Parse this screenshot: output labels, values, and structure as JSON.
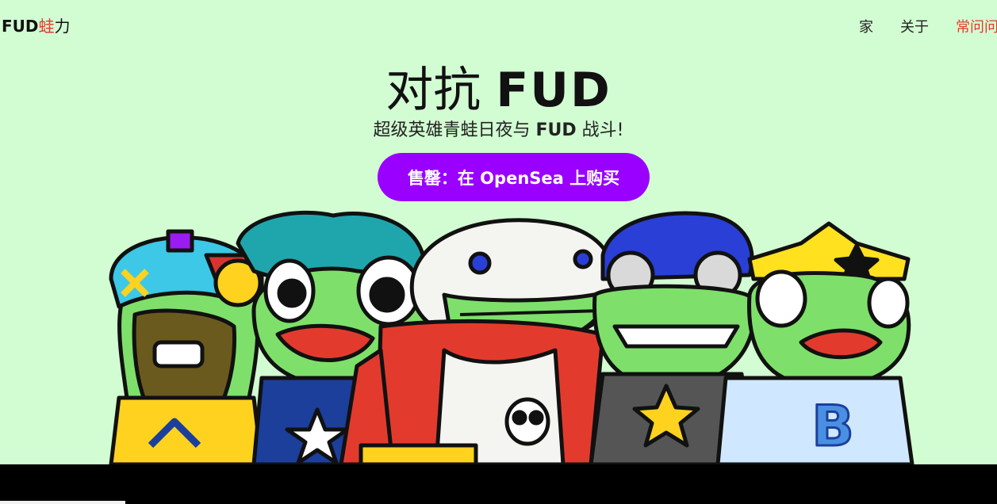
{
  "header": {
    "logo_bold": "FUD",
    "logo_red": "蛙",
    "logo_rest": "力",
    "nav": {
      "home": "家",
      "about": "关于",
      "faq": "常问问题"
    }
  },
  "hero": {
    "title_prefix": "对抗",
    "title_bold": "FUD",
    "subtitle_prefix": "超级英雄青蛙日夜与",
    "subtitle_bold": "FUD",
    "subtitle_suffix": "战斗!",
    "cta_label": "售罄：在 OpenSea 上购买"
  },
  "colors": {
    "background": "#d2fcd2",
    "accent_red": "#e23b2e",
    "cta_purple": "#9a00ff",
    "frog_green": "#7ee06a"
  }
}
